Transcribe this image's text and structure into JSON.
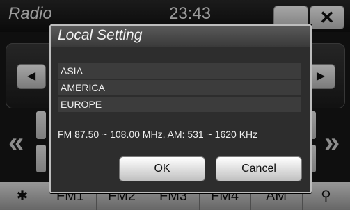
{
  "header": {
    "title": "Radio",
    "clock": "23:43",
    "close_glyph": "✕",
    "blank_button_label": ""
  },
  "tuner": {
    "prev_glyph": "◀",
    "next_glyph": "▶"
  },
  "bottom_bar": {
    "settings_icon": "gear-icon",
    "settings_glyph": "✱",
    "bands": [
      "FM1",
      "FM2",
      "FM3",
      "FM4",
      "AM"
    ],
    "search_icon": "search-icon",
    "search_glyph": "⚲"
  },
  "dialog": {
    "title": "Local Setting",
    "regions": [
      "ASIA",
      "AMERICA",
      "EUROPE"
    ],
    "frequency_range": "FM 87.50 ~ 108.00 MHz, AM: 531 ~ 1620 KHz",
    "ok_label": "OK",
    "cancel_label": "Cancel"
  }
}
